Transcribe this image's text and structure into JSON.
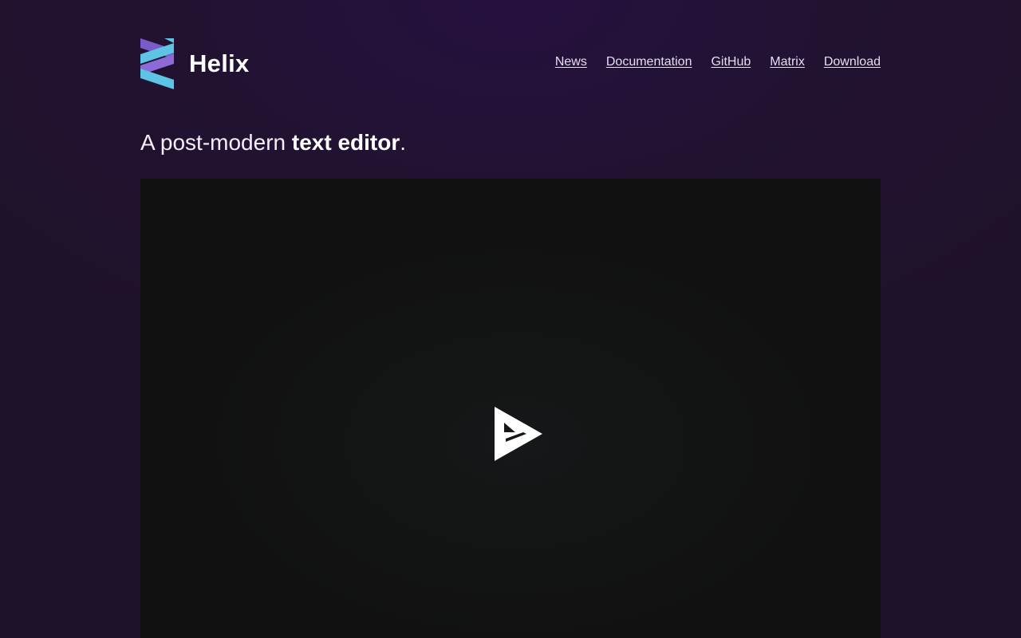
{
  "brand": {
    "name": "Helix",
    "logo_colors": [
      "#7A5CC8",
      "#5DC4E6"
    ]
  },
  "nav": {
    "items": [
      {
        "label": "News"
      },
      {
        "label": "Documentation"
      },
      {
        "label": "GitHub"
      },
      {
        "label": "Matrix"
      },
      {
        "label": "Download"
      }
    ]
  },
  "hero": {
    "tagline_prefix": "A post-modern ",
    "tagline_emphasis": "text editor",
    "tagline_suffix": "."
  },
  "demo": {
    "play_icon": "play-icon"
  },
  "colors": {
    "background": "#1E1228",
    "player_background": "#111111",
    "text": "#F2EEF8"
  }
}
